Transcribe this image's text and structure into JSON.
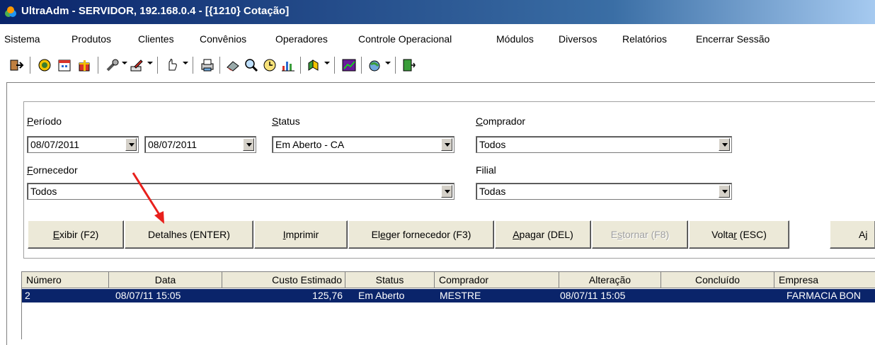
{
  "window": {
    "title": "UltraAdm - SERVIDOR, 192.168.0.4 - [{1210} Cotação]"
  },
  "menu": [
    "Sistema",
    "Produtos",
    "Clientes",
    "Convênios",
    "Operadores",
    "Controle Operacional",
    "Módulos",
    "Diversos",
    "Relatórios",
    "Encerrar Sessão"
  ],
  "toolbar": {
    "icons": [
      "exit-icon",
      "globe-icon",
      "calendar-icon",
      "gift-icon",
      "tools-icon",
      "pencil-icon",
      "hand-icon",
      "printer-icon",
      "eraser-icon",
      "magnifier-icon",
      "clock-icon",
      "chart-icon",
      "palette-icon",
      "graph-icon",
      "globe-star-icon",
      "door-icon"
    ]
  },
  "filters": {
    "periodo_label_u": "P",
    "periodo_label_rest": "eríodo",
    "periodo_from": "08/07/2011",
    "periodo_to": "08/07/2011",
    "status_label_u": "S",
    "status_label_rest": "tatus",
    "status_value": "Em Aberto - CA",
    "comprador_label_u": "C",
    "comprador_label_rest": "omprador",
    "comprador_value": "Todos",
    "fornecedor_label_u": "F",
    "fornecedor_label_rest": "ornecedor",
    "fornecedor_value": "Todos",
    "filial_label": "Filial",
    "filial_value": "Todas"
  },
  "buttons": {
    "exibir_u": "E",
    "exibir_rest": "xibir (F2)",
    "detalhes": "Detalhes (ENTER)",
    "imprimir_u": "I",
    "imprimir_rest": "mprimir",
    "eleger_a": "El",
    "eleger_u": "e",
    "eleger_rest": "ger fornecedor (F3)",
    "apagar_u": "A",
    "apagar_rest": "pagar (DEL)",
    "estornar_a": "E",
    "estornar_u": "s",
    "estornar_rest": "tornar (F8)",
    "voltar_a": "Volta",
    "voltar_u": "r",
    "voltar_rest": " (ESC)",
    "ajuda_partial": "Aj"
  },
  "grid": {
    "columns": [
      "Número",
      "Data",
      "Custo Estimado",
      "Status",
      "Comprador",
      "Alteração",
      "Concluído",
      "Empresa"
    ],
    "rows": [
      [
        "2",
        "08/07/11 15:05",
        "125,76",
        "Em Aberto",
        "MESTRE",
        "08/07/11 15:05",
        "",
        "FARMACIA BON"
      ]
    ]
  },
  "colors": {
    "title_start": "#0a246a",
    "title_end": "#a6caf0",
    "selection": "#0a246a",
    "button_face": "#ece9d8",
    "annotation_arrow": "#e8201c"
  }
}
